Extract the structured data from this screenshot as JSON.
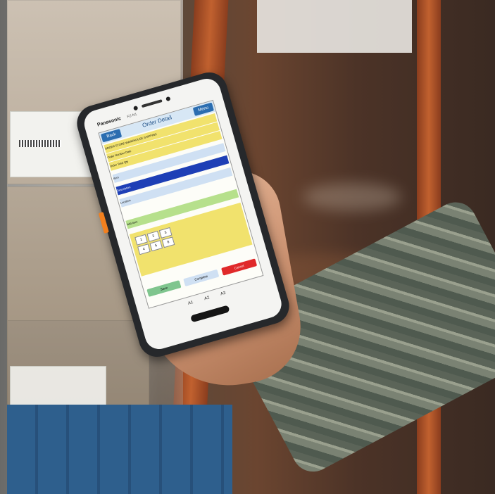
{
  "device": {
    "brand": "Panasonic",
    "model": "FZ-N1",
    "softkeys": [
      "A1",
      "A2",
      "A3"
    ]
  },
  "app": {
    "back_label": "Back",
    "title": "Order Detail",
    "menu_label": "Menu",
    "rows": [
      "ORDER STORE WAREHOUSE SHIPPING",
      "Order Number        Date",
      "Order Total        Qty",
      "Item",
      "Description",
      "Location",
      "Add Item"
    ],
    "keypad": [
      "1",
      "2",
      "3",
      "4",
      "5",
      "6"
    ],
    "buttons": [
      "Save",
      "Complete",
      "Cancel"
    ]
  },
  "colors": {
    "screen_header": "#d7e7f5",
    "row_yellow": "#f1e26d",
    "row_blue": "#1e3fb6",
    "row_green": "#b6e08c",
    "button_red": "#e0292a",
    "phone_body": "#26282b",
    "side_button": "#f2801f"
  }
}
